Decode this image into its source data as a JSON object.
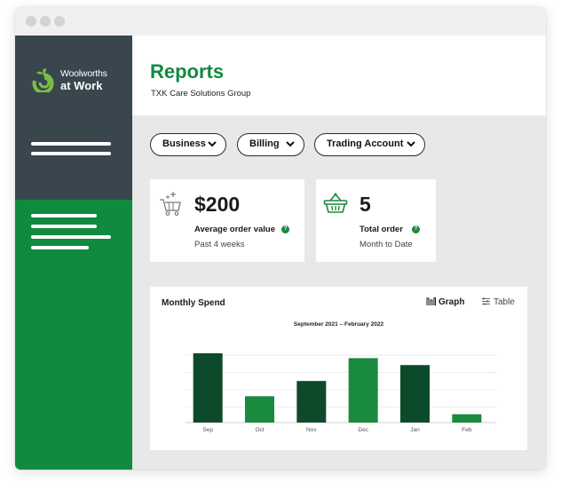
{
  "app": {
    "brand_line1": "Woolworths",
    "brand_line2": "at Work",
    "brand_color": "#128a3f",
    "sidebar_dark_color": "#3a464e",
    "sidebar_green_color": "#0f8a3e"
  },
  "header": {
    "title": "Reports",
    "subtitle": "TXK Care Solutions Group"
  },
  "filters": [
    {
      "label": "Business",
      "icon": "chevron-down-icon"
    },
    {
      "label": "Billing",
      "icon": "chevron-down-icon"
    },
    {
      "label": "Trading Account",
      "icon": "chevron-down-icon"
    }
  ],
  "stats": [
    {
      "value": "$200",
      "label": "Average order value",
      "sub": "Past 4 weeks",
      "icon": "cart-sparkle-icon"
    },
    {
      "value": "5",
      "label": "Total order",
      "sub": "Month to Date",
      "icon": "basket-icon"
    }
  ],
  "chart_card": {
    "title": "Monthly Spend",
    "view_graph_label": "Graph",
    "view_table_label": "Table",
    "active_view": "Graph"
  },
  "chart_data": {
    "type": "bar",
    "title": "September 2021 – February 2022",
    "categories": [
      "Sep",
      "Oct",
      "Nov",
      "Dec",
      "Jan",
      "Feb"
    ],
    "values": [
      100,
      38,
      60,
      93,
      83,
      12
    ],
    "colors": [
      "#0d4a2a",
      "#1a8a3f",
      "#0d4a2a",
      "#1a8a3f",
      "#0d4a2a",
      "#1a8a3f"
    ],
    "grid": true,
    "ylim": [
      0,
      100
    ]
  }
}
